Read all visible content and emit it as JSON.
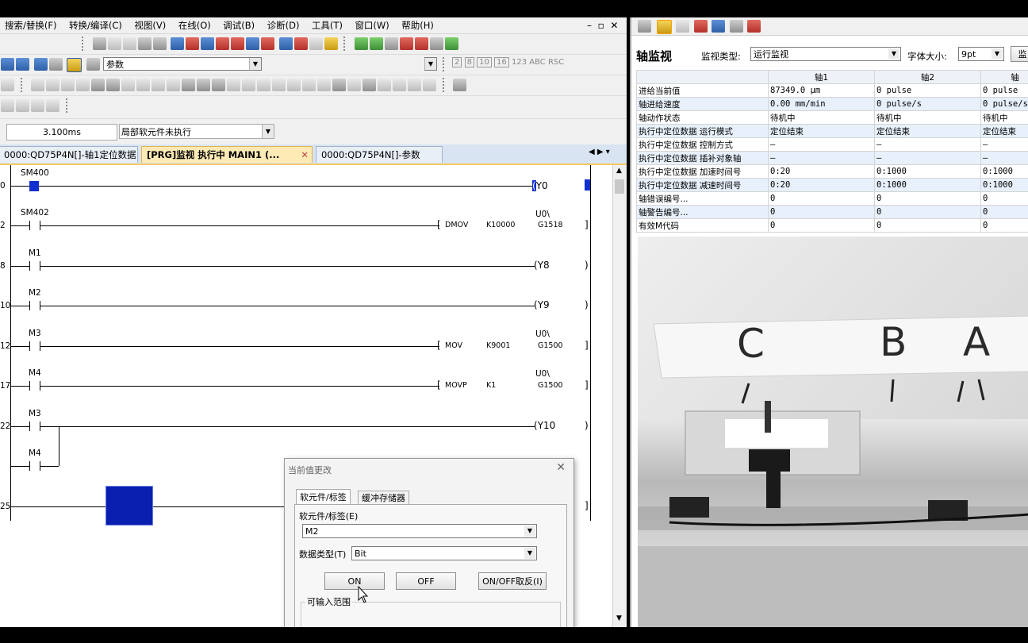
{
  "menu": [
    "搜索/替换(F)",
    "转换/编译(C)",
    "视图(V)",
    "在线(O)",
    "调试(B)",
    "诊断(D)",
    "工具(T)",
    "窗口(W)",
    "帮助(H)"
  ],
  "toolbar": {
    "search_value": "参数",
    "scan_time": "3.100ms",
    "exec_status": "局部软元件未执行",
    "num_buttons": [
      "2",
      "8",
      "10",
      "16",
      "123",
      "ABC",
      "RSC"
    ]
  },
  "tabs": [
    {
      "label": "0000:QD75P4N[]-轴1定位数据"
    },
    {
      "label": "[PRG]监视 执行中 MAIN1 (..."
    },
    {
      "label": "0000:QD75P4N[]-参数"
    }
  ],
  "ladder": {
    "rungs": [
      {
        "step": "0",
        "contact": "SM400",
        "output": "Y0"
      },
      {
        "step": "2",
        "contact": "SM402",
        "inst": "DMOV",
        "op1": "K10000",
        "op2_top": "U0\\",
        "op2": "G1518"
      },
      {
        "step": "8",
        "contact": "M1",
        "output": "Y8"
      },
      {
        "step": "10",
        "contact": "M2",
        "output": "Y9"
      },
      {
        "step": "12",
        "contact": "M3",
        "inst": "MOV",
        "op1": "K9001",
        "op2_top": "U0\\",
        "op2": "G1500"
      },
      {
        "step": "17",
        "contact": "M4",
        "inst": "MOVP",
        "op1": "K1",
        "op2_top": "U0\\",
        "op2": "G1500"
      },
      {
        "step": "22",
        "contact": "M3",
        "contact2": "M4",
        "output": "Y10"
      },
      {
        "step": "25"
      }
    ]
  },
  "dialog": {
    "title": "当前值更改",
    "tab1": "软元件/标签",
    "tab2": "缓冲存储器",
    "device_label": "软元件/标签(E)",
    "device_value": "M2",
    "datatype_label": "数据类型(T)",
    "datatype_value": "Bit",
    "btn_on": "ON",
    "btn_off": "OFF",
    "btn_toggle": "ON/OFF取反(I)",
    "range_label": "可输入范围"
  },
  "axis_monitor": {
    "title": "轴监视",
    "type_label": "监视类型:",
    "type_value": "运行监视",
    "font_label": "字体大小:",
    "font_value": "9pt",
    "cut_label": "监",
    "columns": [
      "轴1",
      "轴2",
      "轴"
    ],
    "rows": [
      {
        "name": "进给当前值",
        "v": [
          "87349.0 μm",
          "0 pulse",
          "0 pulse"
        ]
      },
      {
        "name": "轴进给速度",
        "v": [
          "0.00 mm/min",
          "0 pulse/s",
          "0 pulse/s"
        ]
      },
      {
        "name": "轴动作状态",
        "v": [
          "待机中",
          "待机中",
          "待机中"
        ]
      },
      {
        "name": "执行中定位数据 运行模式",
        "v": [
          "定位结束",
          "定位结束",
          "定位结束"
        ]
      },
      {
        "name": "执行中定位数据 控制方式",
        "v": [
          "–",
          "–",
          "–"
        ]
      },
      {
        "name": "执行中定位数据 插补对象轴",
        "v": [
          "–",
          "–",
          "–"
        ]
      },
      {
        "name": "执行中定位数据 加速时间号",
        "v": [
          "0:20",
          "0:1000",
          "0:1000"
        ]
      },
      {
        "name": "执行中定位数据 减速时间号",
        "v": [
          "0:20",
          "0:1000",
          "0:1000"
        ]
      },
      {
        "name": "轴错误编号...",
        "v": [
          "0",
          "0",
          "0"
        ]
      },
      {
        "name": "轴警告编号...",
        "v": [
          "0",
          "0",
          "0"
        ]
      },
      {
        "name": "有效M代码",
        "v": [
          "0",
          "0",
          "0"
        ]
      }
    ]
  },
  "photo": {
    "labels": [
      "C",
      "B",
      "A"
    ]
  }
}
